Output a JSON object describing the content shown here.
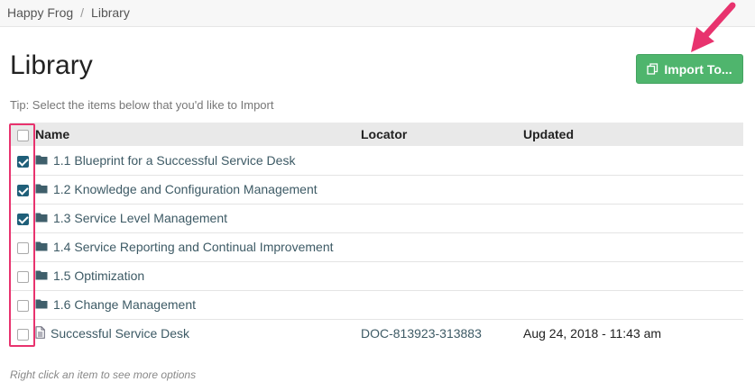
{
  "breadcrumb": {
    "root": "Happy Frog",
    "separator": "/",
    "current": "Library"
  },
  "page": {
    "title": "Library",
    "tip": "Tip: Select the items below that you'd like to Import",
    "footnote": "Right click an item to see more options"
  },
  "actions": {
    "import_label": "Import To..."
  },
  "table": {
    "headers": {
      "name": "Name",
      "locator": "Locator",
      "updated": "Updated"
    },
    "rows": [
      {
        "type": "folder",
        "name": "1.1 Blueprint for a Successful Service Desk",
        "locator": "",
        "updated": "",
        "checked": true
      },
      {
        "type": "folder",
        "name": "1.2 Knowledge and Configuration Management",
        "locator": "",
        "updated": "",
        "checked": true
      },
      {
        "type": "folder",
        "name": "1.3 Service Level Management",
        "locator": "",
        "updated": "",
        "checked": true
      },
      {
        "type": "folder",
        "name": "1.4 Service Reporting and Continual Improvement",
        "locator": "",
        "updated": "",
        "checked": false
      },
      {
        "type": "folder",
        "name": "1.5 Optimization",
        "locator": "",
        "updated": "",
        "checked": false
      },
      {
        "type": "folder",
        "name": "1.6 Change Management",
        "locator": "",
        "updated": "",
        "checked": false
      },
      {
        "type": "document",
        "name": "Successful Service Desk",
        "locator": "DOC-813923-313883",
        "updated": "Aug 24, 2018 - 11:43 am",
        "checked": false
      }
    ]
  },
  "colors": {
    "accent_button": "#4fb56d",
    "annotation": "#e8336e",
    "checkbox_checked": "#1f5f79",
    "link_text": "#3d5a65"
  },
  "icons": {
    "import": "copy-icon",
    "folder": "folder-icon",
    "document": "document-icon"
  }
}
